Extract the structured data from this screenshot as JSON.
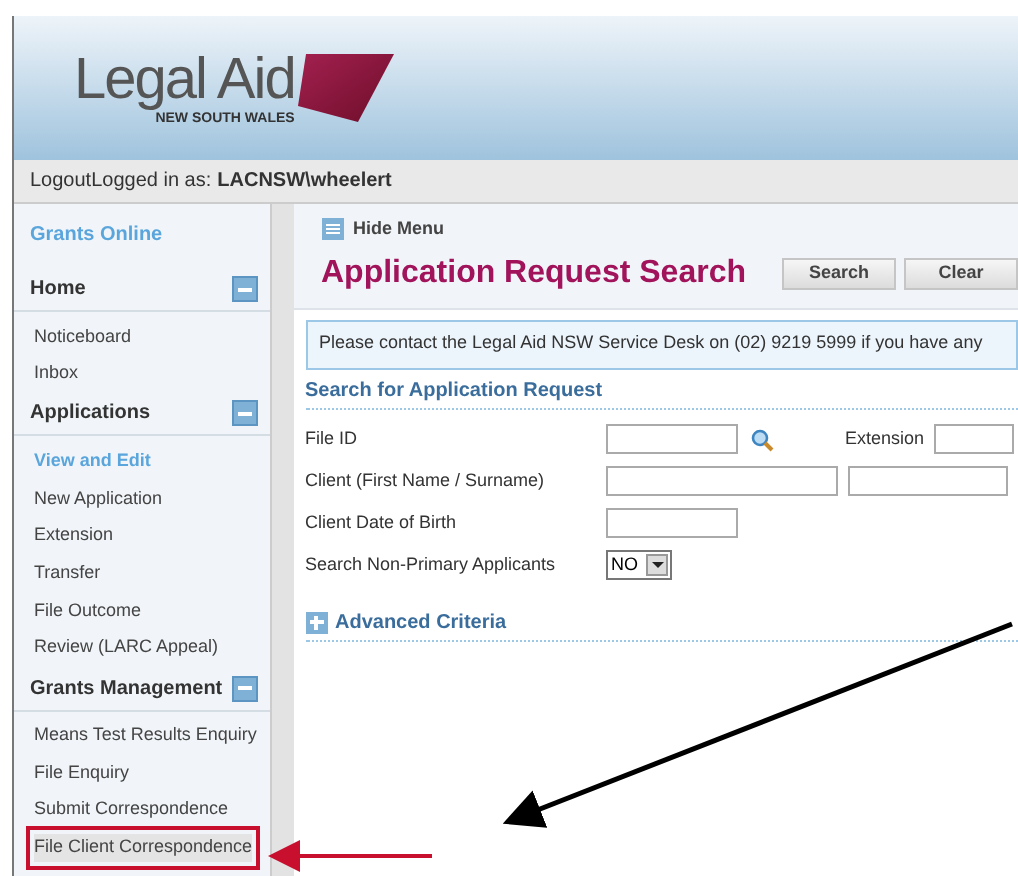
{
  "logo": {
    "name": "Legal Aid",
    "subtitle": "NEW SOUTH WALES"
  },
  "login_bar": {
    "logout": "Logout",
    "label": "Logged in as:",
    "user": "LACNSW\\wheelert"
  },
  "sidebar": {
    "title": "Grants Online",
    "sections": [
      {
        "title": "Home",
        "expanded": true,
        "items": [
          {
            "label": "Noticeboard",
            "selected": false,
            "callout": false
          },
          {
            "label": "Inbox",
            "selected": false,
            "callout": false
          }
        ]
      },
      {
        "title": "Applications",
        "expanded": true,
        "items": [
          {
            "label": "View and Edit",
            "selected": true,
            "callout": false
          },
          {
            "label": "New Application",
            "selected": false,
            "callout": false
          },
          {
            "label": "Extension",
            "selected": false,
            "callout": false
          },
          {
            "label": "Transfer",
            "selected": false,
            "callout": false
          },
          {
            "label": "File Outcome",
            "selected": false,
            "callout": false
          },
          {
            "label": "Review (LARC Appeal)",
            "selected": false,
            "callout": false
          }
        ]
      },
      {
        "title": "Grants Management",
        "expanded": true,
        "items": [
          {
            "label": "Means Test Results Enquiry",
            "selected": false,
            "callout": false
          },
          {
            "label": "File Enquiry",
            "selected": false,
            "callout": false
          },
          {
            "label": "Submit Correspondence",
            "selected": false,
            "callout": false
          },
          {
            "label": "File Client Correspondence",
            "selected": false,
            "callout": true
          }
        ]
      }
    ]
  },
  "hide_menu": "Hide Menu",
  "page_title": "Application Request Search",
  "buttons": [
    "Search",
    "Clear"
  ],
  "notice": "Please contact the Legal Aid NSW Service Desk on (02) 9219 5999 if you have any",
  "form": {
    "title": "Search for Application Request",
    "fields": [
      {
        "label": "File ID",
        "kind": "fileid",
        "extension_label": "Extension"
      },
      {
        "label": "Client (First Name / Surname)",
        "kind": "name"
      },
      {
        "label": "Client Date of Birth",
        "kind": "text"
      },
      {
        "label": "Search Non-Primary Applicants",
        "kind": "select",
        "value": "NO"
      }
    ]
  },
  "advanced": {
    "label": "Advanced Criteria",
    "expanded": false
  }
}
